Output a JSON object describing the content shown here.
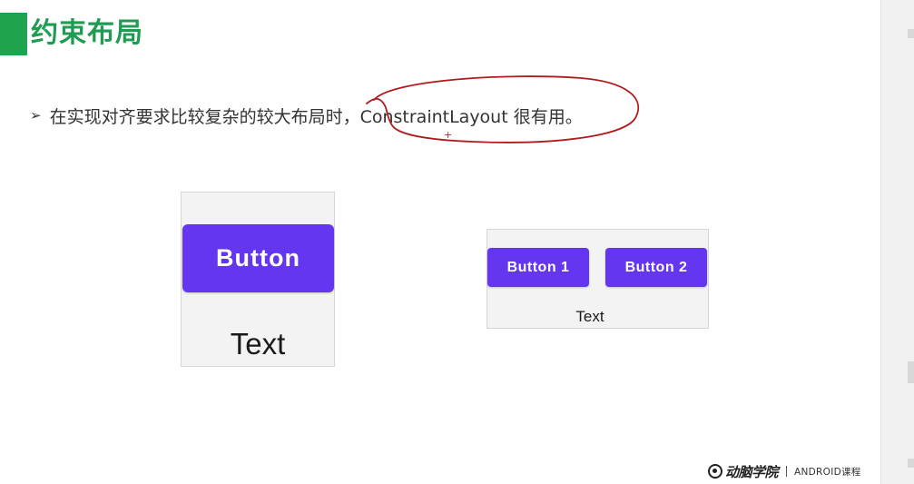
{
  "slide": {
    "title": "约束布局",
    "bullet_marker": "➢",
    "bullet_text": "在实现对齐要求比较复杂的较大布局时，ConstraintLayout 很有用。"
  },
  "example_single": {
    "button_label": "Button",
    "text_label": "Text"
  },
  "example_double": {
    "button1_label": "Button 1",
    "button2_label": "Button 2",
    "text_label": "Text"
  },
  "footer": {
    "logo_text": "动脑学院",
    "course_label": "ANDROID课程"
  },
  "colors": {
    "title_green": "#1f9c52",
    "accent_bar": "#1fa34f",
    "button_purple": "#6436f0",
    "annotation_red": "#b01c1c"
  }
}
